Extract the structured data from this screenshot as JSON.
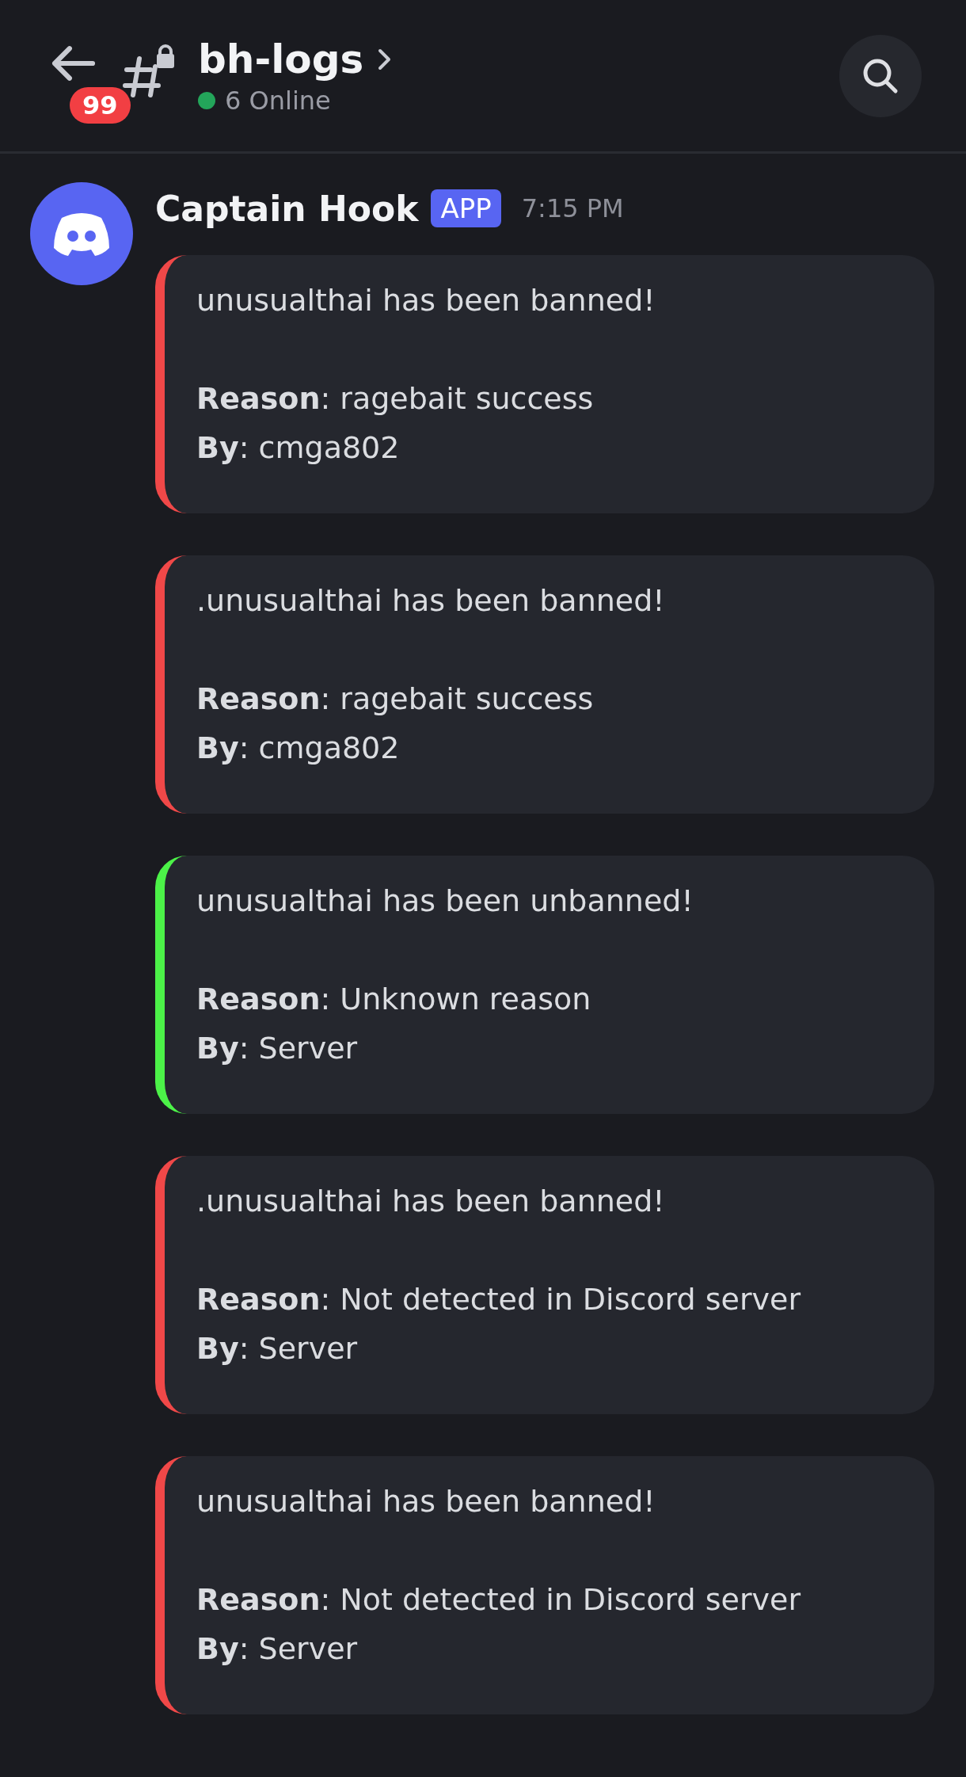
{
  "header": {
    "unread_badge": "99",
    "channel_name": "bh-logs",
    "online_status": "6 Online"
  },
  "message": {
    "author": "Captain Hook",
    "author_tag": "APP",
    "timestamp": "7:15 PM",
    "embeds": [
      {
        "color": "#f04848",
        "title": "unusualthai has been banned!",
        "reason": "**Reason**: ragebait success",
        "by": "**By**: cmga802"
      },
      {
        "color": "#f04848",
        "title": ".unusualthai has been banned!",
        "reason": "**Reason**: ragebait success",
        "by": "**By**: cmga802"
      },
      {
        "color": "#4cf248",
        "title": "unusualthai has been unbanned!",
        "reason": "**Reason**: Unknown reason",
        "by": "**By**: Server"
      },
      {
        "color": "#f04848",
        "title": ".unusualthai has been banned!",
        "reason": "**Reason**: Not detected in Discord server",
        "by": "**By**: Server"
      },
      {
        "color": "#f04848",
        "title": "unusualthai has been banned!",
        "reason": "**Reason**: Not detected in Discord server",
        "by": "**By**: Server"
      }
    ]
  }
}
